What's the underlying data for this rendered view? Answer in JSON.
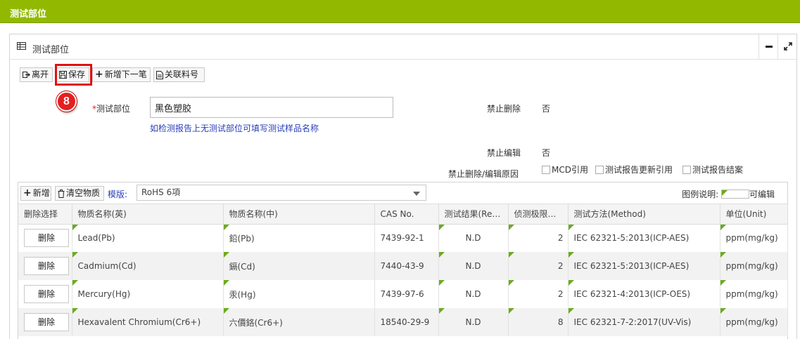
{
  "topbar": {
    "title": "测试部位"
  },
  "panel": {
    "title": "测试部位"
  },
  "toolbar": {
    "leave": "离开",
    "save": "保存",
    "add_next": "新增下一笔",
    "link_part": "关联料号"
  },
  "step_badge": "8",
  "form": {
    "test_part_label": "测试部位",
    "test_part_value": "黑色塑胶",
    "hint": "如检测报告上无测试部位可填写测试样品名称",
    "no_delete_label": "禁止删除",
    "no_delete_value": "否",
    "no_edit_label": "禁止编辑",
    "no_edit_value": "否",
    "reason_label": "禁止删除/编辑原因",
    "reasons": [
      "MCD引用",
      "测试报告更新引用",
      "测试报告结案"
    ]
  },
  "subgrid": {
    "add": "新增",
    "clear": "清空物质",
    "template_label": "模版:",
    "template_value": "RoHS 6項",
    "legend_label": "图例说明:",
    "legend_text": "可编辑",
    "columns": [
      "删除选择",
      "物质名称(英)",
      "物质名称(中)",
      "CAS No.",
      "测试结果(Re…",
      "侦测极限…",
      "测试方法(Method)",
      "单位(Unit)"
    ],
    "delete_label": "删除",
    "rows": [
      {
        "en": "Lead(Pb)",
        "zh": "鉛(Pb)",
        "cas": "7439-92-1",
        "result": "N.D",
        "limit": "2",
        "method": "IEC 62321-5:2013(ICP-AES)",
        "unit": "ppm(mg/kg)"
      },
      {
        "en": "Cadmium(Cd)",
        "zh": "鎘(Cd)",
        "cas": "7440-43-9",
        "result": "N.D",
        "limit": "2",
        "method": "IEC 62321-5:2013(ICP-AES)",
        "unit": "ppm(mg/kg)"
      },
      {
        "en": "Mercury(Hg)",
        "zh": "汞(Hg)",
        "cas": "7439-97-6",
        "result": "N.D",
        "limit": "2",
        "method": "IEC 62321-4:2013(ICP-OES)",
        "unit": "ppm(mg/kg)"
      },
      {
        "en": "Hexavalent Chromium(Cr6+)",
        "zh": "六價鉻(Cr6+)",
        "cas": "18540-29-9",
        "result": "N.D",
        "limit": "8",
        "method": "IEC 62321-7-2:2017(UV-Vis)",
        "unit": "ppm(mg/kg)"
      }
    ]
  },
  "colors": {
    "topbar": "#92b900",
    "editable_marker": "#6cab1d",
    "link": "#2b3fb8",
    "highlight": "#e01010"
  },
  "icons": [
    "grid-icon",
    "minimize-icon",
    "expand-icon",
    "exit-icon",
    "save-icon",
    "plus-icon",
    "document-icon",
    "trash-icon",
    "chevron-down-icon"
  ]
}
